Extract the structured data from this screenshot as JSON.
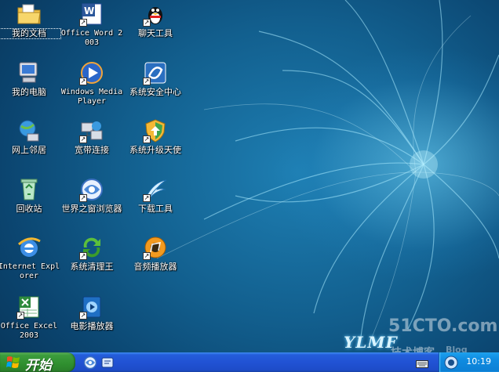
{
  "desktop": {
    "icons": [
      {
        "label": "我的文档",
        "icon": "folder-documents-icon",
        "shortcut": false,
        "selected": true
      },
      {
        "label": "Office Word 2003",
        "icon": "word-icon",
        "shortcut": true
      },
      {
        "label": "聊天工具",
        "icon": "qq-penguin-icon",
        "shortcut": true
      },
      {
        "label": "我的电脑",
        "icon": "computer-icon",
        "shortcut": false
      },
      {
        "label": "Windows Media Player",
        "icon": "media-player-icon",
        "shortcut": true
      },
      {
        "label": "系统安全中心",
        "icon": "security-center-icon",
        "shortcut": true
      },
      {
        "label": "网上邻居",
        "icon": "network-icon",
        "shortcut": false
      },
      {
        "label": "宽带连接",
        "icon": "broadband-icon",
        "shortcut": true
      },
      {
        "label": "系统升级天使",
        "icon": "shield-update-icon",
        "shortcut": true
      },
      {
        "label": "回收站",
        "icon": "recycle-bin-icon",
        "shortcut": false
      },
      {
        "label": "世界之窗浏览器",
        "icon": "theworld-browser-icon",
        "shortcut": true
      },
      {
        "label": "下载工具",
        "icon": "download-tool-icon",
        "shortcut": true
      },
      {
        "label": "Internet Explorer",
        "icon": "internet-explorer-icon",
        "shortcut": false
      },
      {
        "label": "系统清理王",
        "icon": "system-cleaner-icon",
        "shortcut": true
      },
      {
        "label": "音频播放器",
        "icon": "audio-player-icon",
        "shortcut": true
      },
      {
        "label": "Office Excel 2003",
        "icon": "excel-icon",
        "shortcut": true
      },
      {
        "label": "电影播放器",
        "icon": "movie-player-icon",
        "shortcut": true
      }
    ]
  },
  "watermark": {
    "site": "51CTO.com",
    "blog": "技术博客",
    "blog_en": "Blog",
    "logo": "YLMF"
  },
  "taskbar": {
    "start_label": "开始",
    "quicklaunch": [
      "theworld-browser-icon",
      "show-desktop-icon"
    ],
    "tray_icons": [
      "volume-icon",
      "keyboard-icon"
    ],
    "clock": "10:19"
  },
  "colors": {
    "taskbar": "#245edb",
    "start_button": "#3c9c3c",
    "tray": "#0f8be0",
    "desktop_bg": "#125f8e"
  }
}
